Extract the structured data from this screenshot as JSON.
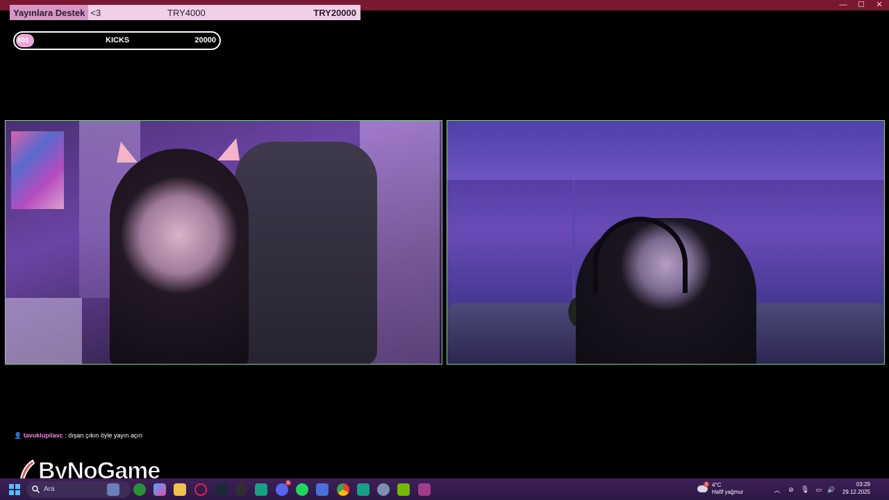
{
  "window": {
    "minimize_glyph": "—",
    "maximize_glyph": "☐",
    "close_glyph": "✕"
  },
  "donation_goal": {
    "label": "Yayınlara Destek",
    "extra": "<3",
    "current": "TRY4000",
    "target": "TRY20000",
    "progress_fraction": 0.2
  },
  "kicks": {
    "count": "601",
    "label": "KICKS",
    "target": "20000",
    "progress_fraction": 0.03
  },
  "chat": {
    "user": "tavuklupilavc",
    "separator": ":",
    "message": "dışarı çıkın öyle yayın açın"
  },
  "brand": {
    "name": "ByNoGame"
  },
  "taskbar": {
    "search_placeholder": "Ara",
    "icons": [
      "windows-start-icon",
      "search-icon",
      "file-explorer-icon",
      "xbox-icon",
      "copilot-icon",
      "folder-icon",
      "opera-gx-icon",
      "steam-icon",
      "obs-icon",
      "dcbot-icon",
      "discord-icon",
      "spotify-icon",
      "network-icon",
      "chrome-icon",
      "discord-alt-icon",
      "settings-icon",
      "nvidia-icon",
      "winrar-icon"
    ],
    "discord_badge": "5",
    "weather": {
      "temp": "4°C",
      "desc": "Hafif yağmur",
      "badge": "3"
    },
    "clock": {
      "time": "03:29",
      "date": "29.12.2025"
    }
  },
  "colors": {
    "titlebar": "#7a1832",
    "goal_bg": "#f1cfe9",
    "goal_label_bg": "#d597c6",
    "cam_border": "#8cd0a3",
    "taskbar": "#2d1846"
  }
}
